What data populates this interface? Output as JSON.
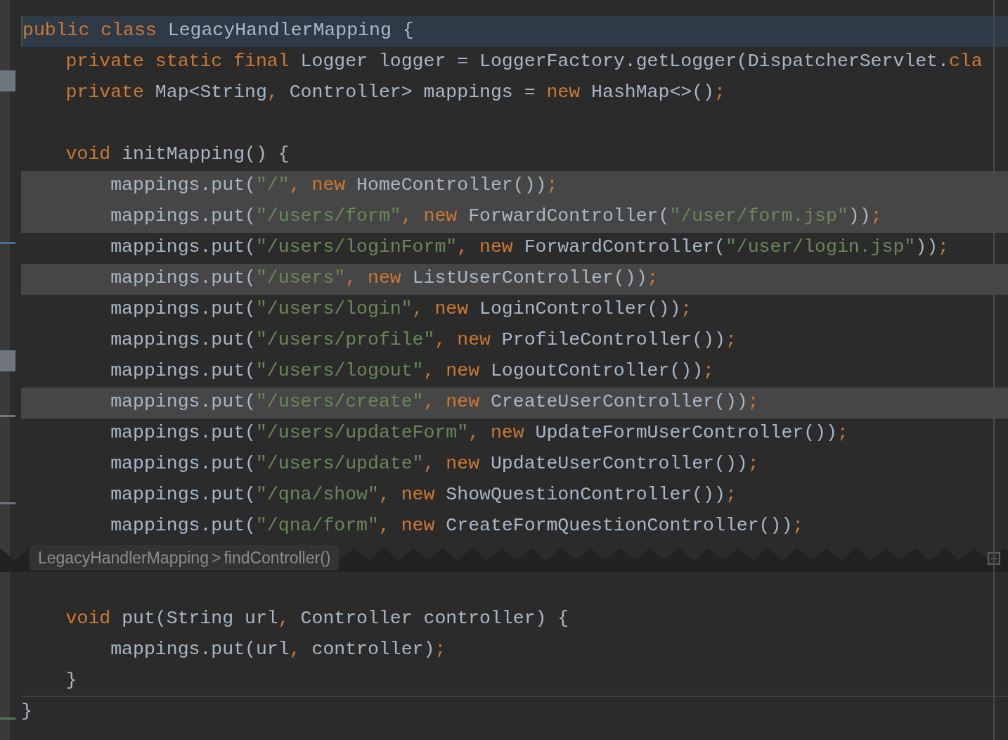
{
  "editor": {
    "lines_before_fold": [
      {
        "kind": "code",
        "caret": true,
        "highlighted": false,
        "separator_below": false,
        "tokens": [
          {
            "kind": "keyword",
            "text": "public class "
          },
          {
            "kind": "plain",
            "text": "LegacyHandlerMapping {"
          }
        ]
      },
      {
        "kind": "code",
        "caret": false,
        "highlighted": false,
        "separator_below": false,
        "tokens": [
          {
            "kind": "keyword",
            "text": "    private static final "
          },
          {
            "kind": "plain",
            "text": "Logger logger = LoggerFactory.getLogger(DispatcherServlet."
          },
          {
            "kind": "keyword",
            "text": "cla"
          }
        ]
      },
      {
        "kind": "code",
        "caret": false,
        "highlighted": false,
        "separator_below": false,
        "tokens": [
          {
            "kind": "keyword",
            "text": "    private "
          },
          {
            "kind": "plain",
            "text": "Map<String"
          },
          {
            "kind": "keyword",
            "text": ","
          },
          {
            "kind": "plain",
            "text": " Controller> mappings = "
          },
          {
            "kind": "keyword",
            "text": "new "
          },
          {
            "kind": "plain",
            "text": "HashMap<>()"
          },
          {
            "kind": "keyword",
            "text": ";"
          }
        ]
      },
      {
        "kind": "blank",
        "caret": false,
        "highlighted": false,
        "separator_below": false
      },
      {
        "kind": "code",
        "caret": false,
        "highlighted": false,
        "separator_below": false,
        "tokens": [
          {
            "kind": "keyword",
            "text": "    void "
          },
          {
            "kind": "plain",
            "text": "initMapping() {"
          }
        ]
      },
      {
        "kind": "code",
        "caret": false,
        "highlighted": true,
        "separator_below": false,
        "tokens": [
          {
            "kind": "plain",
            "text": "        mappings.put("
          },
          {
            "kind": "string",
            "text": "\"/\""
          },
          {
            "kind": "keyword",
            "text": ", new "
          },
          {
            "kind": "plain",
            "text": "HomeController())"
          },
          {
            "kind": "keyword",
            "text": ";"
          }
        ]
      },
      {
        "kind": "code",
        "caret": false,
        "highlighted": true,
        "separator_below": false,
        "tokens": [
          {
            "kind": "plain",
            "text": "        mappings.put("
          },
          {
            "kind": "string",
            "text": "\"/users/form\""
          },
          {
            "kind": "keyword",
            "text": ", new "
          },
          {
            "kind": "plain",
            "text": "ForwardController("
          },
          {
            "kind": "string",
            "text": "\"/user/form.jsp\""
          },
          {
            "kind": "plain",
            "text": "))"
          },
          {
            "kind": "keyword",
            "text": ";"
          }
        ]
      },
      {
        "kind": "code",
        "caret": false,
        "highlighted": false,
        "separator_below": false,
        "tokens": [
          {
            "kind": "plain",
            "text": "        mappings.put("
          },
          {
            "kind": "string",
            "text": "\"/users/loginForm\""
          },
          {
            "kind": "keyword",
            "text": ", new "
          },
          {
            "kind": "plain",
            "text": "ForwardController("
          },
          {
            "kind": "string",
            "text": "\"/user/login.jsp\""
          },
          {
            "kind": "plain",
            "text": "))"
          },
          {
            "kind": "keyword",
            "text": ";"
          }
        ]
      },
      {
        "kind": "code",
        "caret": false,
        "highlighted": true,
        "separator_below": false,
        "tokens": [
          {
            "kind": "plain",
            "text": "        mappings.put("
          },
          {
            "kind": "string",
            "text": "\"/users\""
          },
          {
            "kind": "keyword",
            "text": ", new "
          },
          {
            "kind": "plain",
            "text": "ListUserController())"
          },
          {
            "kind": "keyword",
            "text": ";"
          }
        ]
      },
      {
        "kind": "code",
        "caret": false,
        "highlighted": false,
        "separator_below": false,
        "tokens": [
          {
            "kind": "plain",
            "text": "        mappings.put("
          },
          {
            "kind": "string",
            "text": "\"/users/login\""
          },
          {
            "kind": "keyword",
            "text": ", new "
          },
          {
            "kind": "plain",
            "text": "LoginController())"
          },
          {
            "kind": "keyword",
            "text": ";"
          }
        ]
      },
      {
        "kind": "code",
        "caret": false,
        "highlighted": false,
        "separator_below": false,
        "tokens": [
          {
            "kind": "plain",
            "text": "        mappings.put("
          },
          {
            "kind": "string",
            "text": "\"/users/profile\""
          },
          {
            "kind": "keyword",
            "text": ", new "
          },
          {
            "kind": "plain",
            "text": "ProfileController())"
          },
          {
            "kind": "keyword",
            "text": ";"
          }
        ]
      },
      {
        "kind": "code",
        "caret": false,
        "highlighted": false,
        "separator_below": false,
        "tokens": [
          {
            "kind": "plain",
            "text": "        mappings.put("
          },
          {
            "kind": "string",
            "text": "\"/users/logout\""
          },
          {
            "kind": "keyword",
            "text": ", new "
          },
          {
            "kind": "plain",
            "text": "LogoutController())"
          },
          {
            "kind": "keyword",
            "text": ";"
          }
        ]
      },
      {
        "kind": "code",
        "caret": false,
        "highlighted": true,
        "separator_below": false,
        "tokens": [
          {
            "kind": "plain",
            "text": "        mappings.put("
          },
          {
            "kind": "string",
            "text": "\"/users/create\""
          },
          {
            "kind": "keyword",
            "text": ", new "
          },
          {
            "kind": "plain",
            "text": "CreateUserController())"
          },
          {
            "kind": "keyword",
            "text": ";"
          }
        ]
      },
      {
        "kind": "code",
        "caret": false,
        "highlighted": false,
        "separator_below": false,
        "tokens": [
          {
            "kind": "plain",
            "text": "        mappings.put("
          },
          {
            "kind": "string",
            "text": "\"/users/updateForm\""
          },
          {
            "kind": "keyword",
            "text": ", new "
          },
          {
            "kind": "plain",
            "text": "UpdateFormUserController())"
          },
          {
            "kind": "keyword",
            "text": ";"
          }
        ]
      },
      {
        "kind": "code",
        "caret": false,
        "highlighted": false,
        "separator_below": false,
        "tokens": [
          {
            "kind": "plain",
            "text": "        mappings.put("
          },
          {
            "kind": "string",
            "text": "\"/users/update\""
          },
          {
            "kind": "keyword",
            "text": ", new "
          },
          {
            "kind": "plain",
            "text": "UpdateUserController())"
          },
          {
            "kind": "keyword",
            "text": ";"
          }
        ]
      },
      {
        "kind": "code",
        "caret": false,
        "highlighted": false,
        "separator_below": false,
        "tokens": [
          {
            "kind": "plain",
            "text": "        mappings.put("
          },
          {
            "kind": "string",
            "text": "\"/qna/show\""
          },
          {
            "kind": "keyword",
            "text": ", new "
          },
          {
            "kind": "plain",
            "text": "ShowQuestionController())"
          },
          {
            "kind": "keyword",
            "text": ";"
          }
        ]
      },
      {
        "kind": "code",
        "caret": false,
        "highlighted": false,
        "separator_below": false,
        "tokens": [
          {
            "kind": "plain",
            "text": "        mappings.put("
          },
          {
            "kind": "string",
            "text": "\"/qna/form\""
          },
          {
            "kind": "keyword",
            "text": ", new "
          },
          {
            "kind": "plain",
            "text": "CreateFormQuestionController())"
          },
          {
            "kind": "keyword",
            "text": ";"
          }
        ]
      }
    ],
    "breadcrumb": {
      "items": [
        "LegacyHandlerMapping",
        "findController()"
      ],
      "separator": ">"
    },
    "lines_after_fold": [
      {
        "kind": "blank",
        "caret": false,
        "highlighted": false,
        "separator_below": false
      },
      {
        "kind": "code",
        "caret": false,
        "highlighted": false,
        "separator_below": false,
        "tokens": [
          {
            "kind": "keyword",
            "text": "    void "
          },
          {
            "kind": "plain",
            "text": "put(String url"
          },
          {
            "kind": "keyword",
            "text": ","
          },
          {
            "kind": "plain",
            "text": " Controller controller) {"
          }
        ]
      },
      {
        "kind": "code",
        "caret": false,
        "highlighted": false,
        "separator_below": false,
        "tokens": [
          {
            "kind": "plain",
            "text": "        mappings.put(url"
          },
          {
            "kind": "keyword",
            "text": ","
          },
          {
            "kind": "plain",
            "text": " controller)"
          },
          {
            "kind": "keyword",
            "text": ";"
          }
        ]
      },
      {
        "kind": "code",
        "caret": false,
        "highlighted": false,
        "separator_below": true,
        "tokens": [
          {
            "kind": "plain",
            "text": "    }"
          }
        ]
      },
      {
        "kind": "code",
        "caret": false,
        "highlighted": false,
        "separator_below": false,
        "tokens": [
          {
            "kind": "plain",
            "text": "}"
          }
        ]
      }
    ]
  }
}
